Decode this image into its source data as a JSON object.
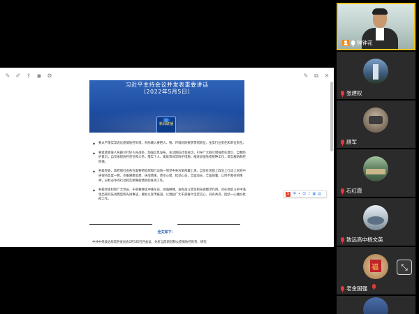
{
  "document": {
    "banner": {
      "title_line1": "习近平主持会议并发表重要讲话",
      "title_line2": "（2022年5月5日）",
      "logo_text": "新闻联播"
    },
    "bullets": [
      "要从严落实常态化疫情防控举措，外防输入要把人、物、环境同防要求贯彻到位，压实行业责任和单位责任。",
      "要紧紧依靠人民群众打好人民战争，加强信息发布，主动回应社会关切，引导广大群众增强责任意识、自我防护意识，自觉承担防控责任和义务，落实个人、家庭等日常防护措施，推进加强免疫接种工作，筑牢群防群控防线。",
      "各级党委、政府和社会各方面要把思想和行动统一到党中央决策部署上来，自觉在思想上政治上行动上同党中央保持高度一致，克服麻痹思想、厌战情绪、侥幸心理、松劲心态，全面动员、全面部署，以时不我待的精神，分秒必争的行动抓实抓细疫情防控各项工作。",
      "各级党组织和广大党员、干部要继续冲锋在前、顽强拼搏，发挥战斗堡垒和先锋模范作用。对在抗疫斗争中涌现出来的先进典型和先进事迹，要加以宣传报道，以激励广大干部群众坚定信心、同舟共济，团结一心做好抗疫工作。"
    ],
    "fulltext_label": "全文如下：",
    "last_paragraph": "中共中央政治局常务委员会5月5日召开会议，分析当前新冠肺炎疫情防控形势，研究"
  },
  "participants": [
    {
      "name": "钟钟花",
      "mic": "on",
      "active": true
    },
    {
      "name": "张建权",
      "mic": "muted"
    },
    {
      "name": "顾军",
      "mic": "muted"
    },
    {
      "name": "石红霞",
      "mic": "muted"
    },
    {
      "name": "致远高中杨文英",
      "mic": "muted"
    },
    {
      "name": "老金国强",
      "mic": "muted"
    },
    {
      "name": "",
      "mic": "muted"
    }
  ],
  "colors": {
    "active_border": "#f1c31e",
    "muted_mic": "#e03b3b",
    "host_badge": "#f28a1e",
    "banner_blue": "#1e4fa5"
  }
}
